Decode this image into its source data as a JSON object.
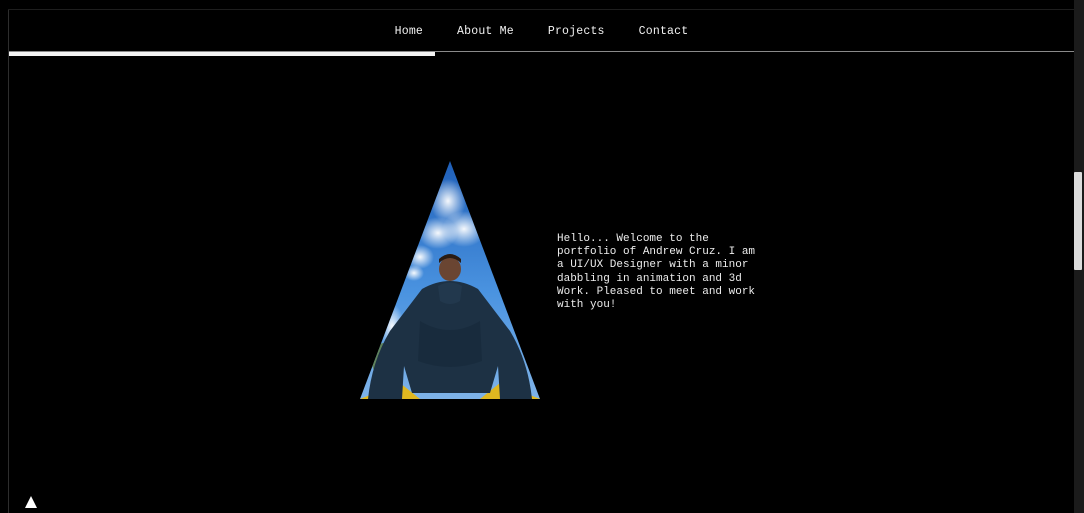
{
  "nav": {
    "items": [
      {
        "label": "Home"
      },
      {
        "label": "About Me"
      },
      {
        "label": "Projects"
      },
      {
        "label": "Contact"
      }
    ]
  },
  "scroll_progress": 0.4,
  "hero": {
    "intro_text": "Hello... Welcome to the portfolio of Andrew Cruz. I am a UI/UX Designer with a minor dabbling in animation and 3d Work. Pleased to meet and work with you!"
  },
  "colors": {
    "background": "#000000",
    "text": "#ededed",
    "accent": "#f4f4f4",
    "sky": "#3d86d8"
  },
  "icons": {
    "scroll_top": "triangle-up-icon"
  }
}
